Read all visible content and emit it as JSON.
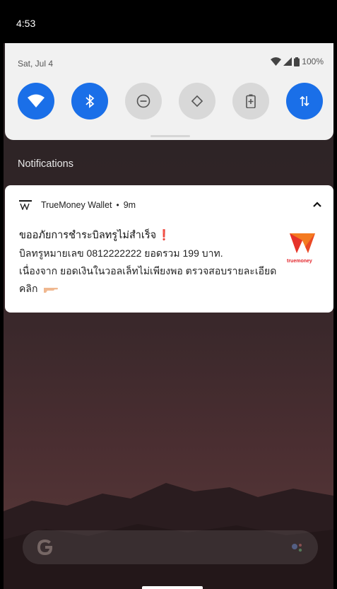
{
  "status_bar": {
    "time": "4:53"
  },
  "quick_settings": {
    "date": "Sat, Jul 4",
    "battery": "100%",
    "tiles": [
      {
        "name": "wifi",
        "active": true
      },
      {
        "name": "bluetooth",
        "active": true
      },
      {
        "name": "do-not-disturb",
        "active": false
      },
      {
        "name": "auto-rotate",
        "active": false
      },
      {
        "name": "battery-saver",
        "active": false
      },
      {
        "name": "mobile-data",
        "active": true
      }
    ]
  },
  "notifications": {
    "header": "Notifications",
    "items": [
      {
        "app_name": "TrueMoney Wallet",
        "separator": "•",
        "time_ago": "9m",
        "title": "ขออภัยการชำระบิลทรูไม่สำเร็จ",
        "title_mark": "❗",
        "body_line1": "บิลทรูหมายเลข 0812222222 ยอดรวม 199 บาท.",
        "body_line2": "เนื่องจาก ยอดเงินในวอลเล็ทไม่เพียงพอ ตรวจสอบรายละเอียด",
        "body_line3": "คลิก",
        "icon_caption": "truemoney"
      }
    ]
  },
  "colors": {
    "accent": "#1a6fe8",
    "truemoney_orange": "#f47a20",
    "truemoney_red": "#e3262b"
  }
}
